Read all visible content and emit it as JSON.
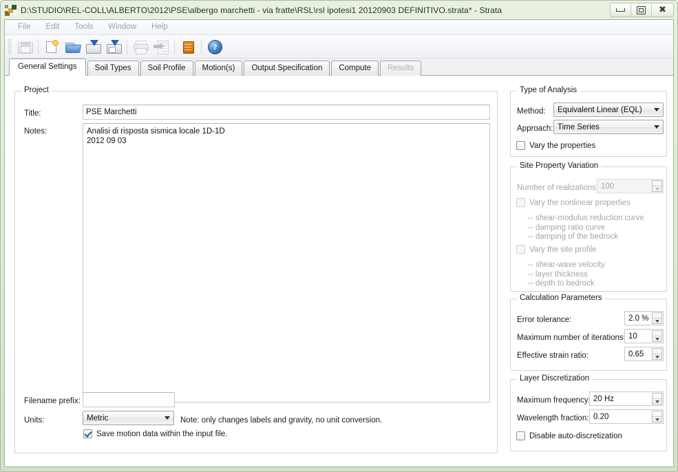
{
  "window": {
    "title": "D:\\STUDIO\\REL-COLL\\ALBERTO\\2012\\PSE\\albergo marchetti - via fratte\\RSL\\rsl ipotesi1 20120903 DEFINITIVO.strata* - Strata",
    "app_icon": "strata-app-icon",
    "controls": {
      "minimize": "–",
      "maximize": "□",
      "close": "✕"
    }
  },
  "menubar": {
    "items": [
      {
        "label": "File"
      },
      {
        "label": "Edit"
      },
      {
        "label": "Tools"
      },
      {
        "label": "Window"
      },
      {
        "label": "Help"
      }
    ]
  },
  "toolbar": {
    "buttons": [
      {
        "name": "save-icon",
        "enabled": false
      },
      {
        "name": "new-document-icon",
        "enabled": true
      },
      {
        "name": "open-folder-icon",
        "enabled": true
      },
      {
        "name": "save-as-icon",
        "enabled": true
      },
      {
        "name": "save-all-icon",
        "enabled": true
      },
      {
        "name": "print-icon",
        "enabled": false
      },
      {
        "name": "export-icon",
        "enabled": false
      },
      {
        "name": "database-icon",
        "enabled": true
      },
      {
        "name": "help-icon",
        "enabled": true,
        "glyph": "?"
      }
    ]
  },
  "tabs": [
    {
      "label": "General Settings",
      "active": true,
      "disabled": false
    },
    {
      "label": "Soil Types",
      "active": false,
      "disabled": false
    },
    {
      "label": "Soil Profile",
      "active": false,
      "disabled": false
    },
    {
      "label": "Motion(s)",
      "active": false,
      "disabled": false
    },
    {
      "label": "Output Specification",
      "active": false,
      "disabled": false
    },
    {
      "label": "Compute",
      "active": false,
      "disabled": false
    },
    {
      "label": "Results",
      "active": false,
      "disabled": true
    }
  ],
  "project": {
    "group_title": "Project",
    "title_label": "Title:",
    "title_value": "PSE Marchetti",
    "notes_label": "Notes:",
    "notes_value": "Analisi di risposta sismica locale 1D-1D\n2012 09 03",
    "filename_prefix_label": "Filename prefix:",
    "filename_prefix_value": "",
    "units_label": "Units:",
    "units_value": "Metric",
    "units_note": "Note: only changes labels and gravity, no unit conversion.",
    "save_motion_label": "Save motion data within the input file.",
    "save_motion_checked": true
  },
  "type_of_analysis": {
    "group_title": "Type of Analysis",
    "method_label": "Method:",
    "method_value": "Equivalent Linear (EQL)",
    "approach_label": "Approach:",
    "approach_value": "Time Series",
    "vary_properties_label": "Vary the properties",
    "vary_properties_checked": false
  },
  "site_property_variation": {
    "group_title": "Site Property Variation",
    "enabled": false,
    "realizations_label": "Number of realizations:",
    "realizations_value": "100",
    "vary_nonlinear_label": "Vary the nonlinear properties",
    "vary_nonlinear_checked": false,
    "nonlinear_items": "-- shear-modulus reduction curve\n-- damping ratio curve\n-- damping of the bedrock",
    "vary_site_profile_label": "Vary the site profile",
    "vary_site_profile_checked": false,
    "site_profile_items": "-- shear-wave velocity\n-- layer thickness\n-- depth to bedrock"
  },
  "calculation_parameters": {
    "group_title": "Calculation Parameters",
    "error_tolerance_label": "Error tolerance:",
    "error_tolerance_value": "2.0 %",
    "max_iterations_label": "Maximum number of iterations:",
    "max_iterations_value": "10",
    "effective_strain_label": "Effective strain ratio:",
    "effective_strain_value": "0.65"
  },
  "layer_discretization": {
    "group_title": "Layer Discretization",
    "max_frequency_label": "Maximum frequency:",
    "max_frequency_value": "20 Hz",
    "wavelength_fraction_label": "Wavelength fraction:",
    "wavelength_fraction_value": "0.20",
    "disable_auto_label": "Disable auto-discretization",
    "disable_auto_checked": false
  },
  "colors": {
    "window_frame": "#d3e0c8",
    "accent_blue": "#2f6fb3",
    "db_orange": "#c56a08",
    "disabled_text": "#a6a6a6"
  }
}
